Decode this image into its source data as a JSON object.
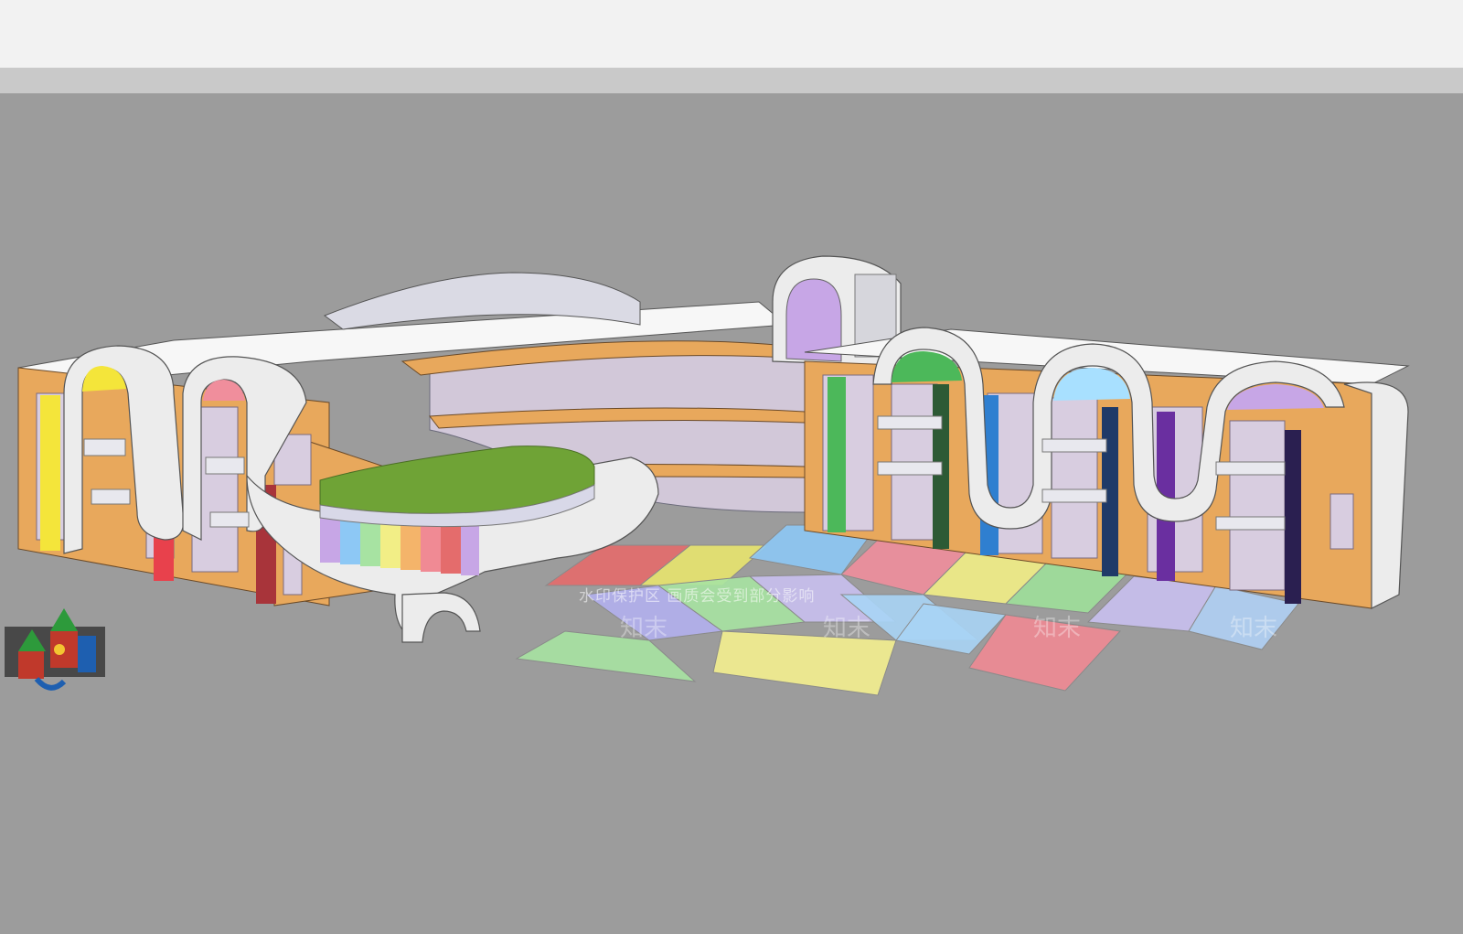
{
  "scene": {
    "sky_color": "#f2f2f2",
    "ground_color": "#9c9c9c",
    "horizon_color": "#c9c9c9",
    "facade_color": "#e8a85c",
    "frame_color": "#ececec",
    "roof_color": "#f7f7f7",
    "glass_color": "#d8cde0",
    "lawn_color": "#6fa336",
    "accent_colors": [
      "#f4e53a",
      "#e8414c",
      "#4cb85a",
      "#2f7fd0",
      "#6a2fa0",
      "#a8e0ff",
      "#c7a6e6"
    ],
    "plaza_tile_colors": [
      "#e46c6c",
      "#e8e46e",
      "#8dc8f5",
      "#f08e9c",
      "#f2ee86",
      "#9fe09a",
      "#c9c0f0",
      "#a9d4f5",
      "#b3b0ee",
      "#a7e3a2",
      "#f4ef8f",
      "#f08a94",
      "#b0d0f5"
    ],
    "playground_colors": [
      "#2d9a3b",
      "#c0392b",
      "#1e5fb0",
      "#f3c531"
    ],
    "icons": [
      "playground-structure-icon"
    ]
  },
  "watermark": {
    "notice": "水印保护区  画质会受到部分影响",
    "brand": "知末"
  }
}
